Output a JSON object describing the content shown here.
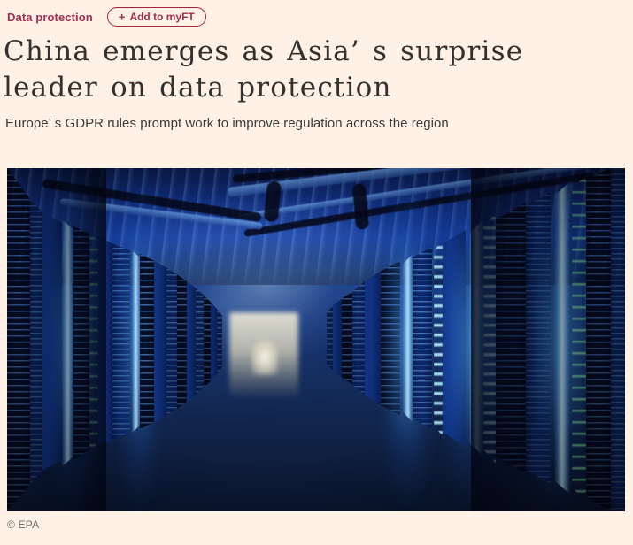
{
  "theme": {
    "background": "#fff1e5",
    "accent": "#9e2f50",
    "button_border": "#a4243f",
    "headline_color": "#33302e",
    "standfirst_color": "#3b3a38",
    "caption_color": "#6b6764"
  },
  "meta": {
    "topic_label": "Data protection",
    "myft_plus_glyph": "+",
    "myft_label": "Add to myFT"
  },
  "article": {
    "headline_line_1": "China emerges as Asia’ s surprise",
    "headline_line_2": "leader on data protection",
    "headline_full": "China emerges as Asia’ s surprise leader on data protection",
    "standfirst": "Europe’ s GDPR rules prompt work to improve regulation across the region"
  },
  "figure": {
    "alt": "Blue-lit data centre corridor lined with server racks",
    "credit_symbol": "©",
    "credit_text": "EPA",
    "credit_full": "© EPA"
  }
}
